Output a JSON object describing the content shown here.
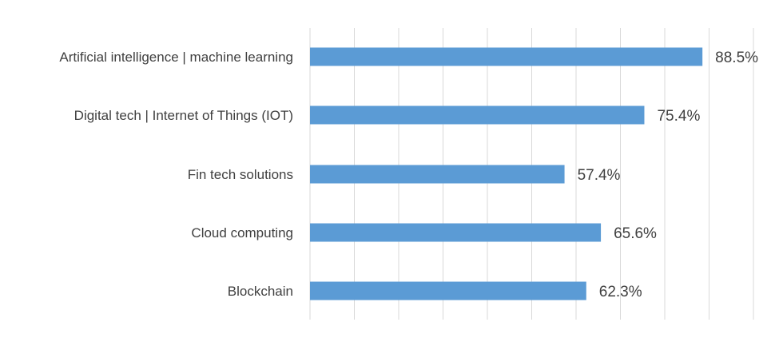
{
  "chart_data": {
    "type": "bar",
    "orientation": "horizontal",
    "categories": [
      "Artificial intelligence | machine learning",
      "Digital tech | Internet of Things (IOT)",
      "Fin tech solutions",
      "Cloud computing",
      "Blockchain"
    ],
    "values": [
      88.5,
      75.4,
      57.4,
      65.6,
      62.3
    ],
    "value_labels": [
      "88.5%",
      "75.4%",
      "57.4%",
      "65.6%",
      "62.3%"
    ],
    "xlim": [
      0,
      100
    ],
    "grid": "vertical",
    "legend": "none",
    "title": "",
    "xlabel": "",
    "ylabel": "",
    "colors": {
      "bar": "#5b9bd5",
      "grid": "#d9d9d9",
      "text": "#404040"
    }
  }
}
